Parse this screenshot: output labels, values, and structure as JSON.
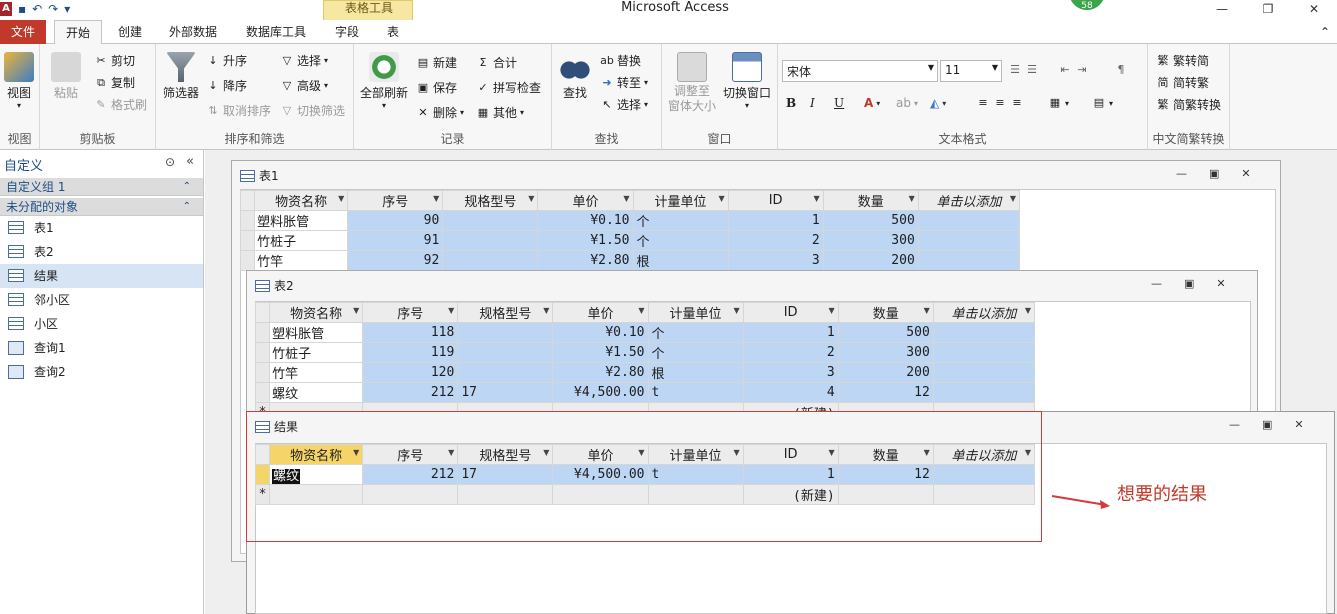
{
  "window": {
    "title": "Microsoft Access",
    "badge": "58"
  },
  "tabs": {
    "file": "文件",
    "home": "开始",
    "create": "创建",
    "external": "外部数据",
    "dbtools": "数据库工具",
    "context_group": "表格工具",
    "fields": "字段",
    "table": "表"
  },
  "ribbon": {
    "view": {
      "view": "视图",
      "label": "视图"
    },
    "clipboard": {
      "paste": "粘贴",
      "cut": "剪切",
      "copy": "复制",
      "painter": "格式刷",
      "label": "剪贴板"
    },
    "sort": {
      "filter": "筛选器",
      "asc": "升序",
      "desc": "降序",
      "remove_sort": "取消排序",
      "select": "选择",
      "advanced": "高级",
      "toggle_filter": "切换筛选",
      "label": "排序和筛选"
    },
    "records": {
      "refresh": "全部刷新",
      "new": "新建",
      "save": "保存",
      "delete": "删除",
      "totals": "合计",
      "spelling": "拼写检查",
      "more": "其他",
      "label": "记录"
    },
    "find": {
      "find": "查找",
      "replace": "替换",
      "goto": "转至",
      "select": "选择",
      "label": "查找"
    },
    "window": {
      "size": "调整至\n窗体大小",
      "switch": "切换窗口",
      "label": "窗口"
    },
    "text": {
      "font": "宋体",
      "size": "11",
      "bold": "B",
      "italic": "I",
      "underline": "U",
      "label": "文本格式"
    },
    "chinese": {
      "t2s": "繁转简",
      "s2t": "简转繁",
      "convert": "简繁转换",
      "label": "中文简繁转换"
    }
  },
  "nav": {
    "header": "自定义",
    "group1": "自定义组 1",
    "group2": "未分配的对象",
    "items": [
      "表1",
      "表2",
      "结果",
      "邻小区",
      "小区",
      "查询1",
      "查询2"
    ]
  },
  "columns": [
    "物资名称",
    "序号",
    "规格型号",
    "单价",
    "计量单位",
    "ID",
    "数量",
    "单击以添加"
  ],
  "table1": {
    "title": "表1",
    "rows": [
      [
        "塑料胀管",
        "90",
        "",
        "¥0.10",
        "个",
        "1",
        "500"
      ],
      [
        "竹桩子",
        "91",
        "",
        "¥1.50",
        "个",
        "2",
        "300"
      ],
      [
        "竹竿",
        "92",
        "",
        "¥2.80",
        "根",
        "3",
        "200"
      ]
    ]
  },
  "table2": {
    "title": "表2",
    "rows": [
      [
        "塑料胀管",
        "118",
        "",
        "¥0.10",
        "个",
        "1",
        "500"
      ],
      [
        "竹桩子",
        "119",
        "",
        "¥1.50",
        "个",
        "2",
        "300"
      ],
      [
        "竹竿",
        "120",
        "",
        "¥2.80",
        "根",
        "3",
        "200"
      ],
      [
        "螺纹",
        "212",
        "17",
        "¥4,500.00",
        "t",
        "4",
        "12"
      ]
    ],
    "new_row": "(新建)"
  },
  "result": {
    "title": "结果",
    "rows": [
      [
        "螺纹",
        "212",
        "17",
        "¥4,500.00",
        "t",
        "1",
        "12"
      ]
    ],
    "new_row": "(新建)"
  },
  "annotation": "想要的结果"
}
